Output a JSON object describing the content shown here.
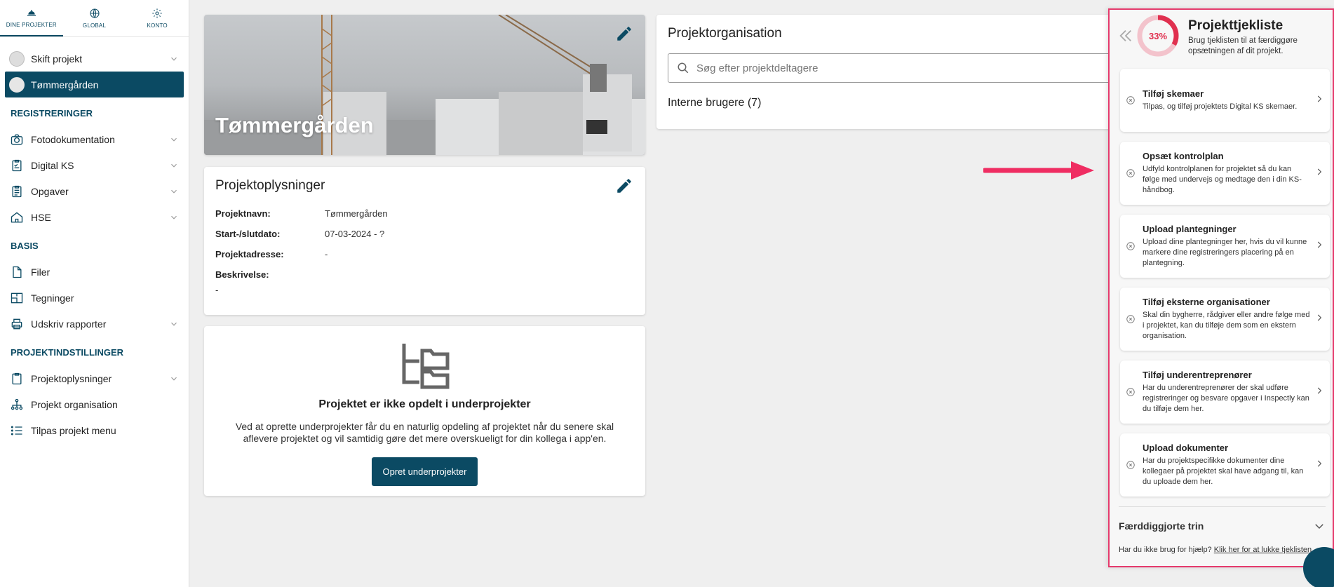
{
  "topnav": [
    {
      "label": "DINE PROJEKTER",
      "icon": "helmet-icon"
    },
    {
      "label": "GLOBAL",
      "icon": "globe-icon"
    },
    {
      "label": "KONTO",
      "icon": "gear-icon"
    }
  ],
  "sidebar": {
    "switch_project": "Skift projekt",
    "current_project": "Tømmergården",
    "sections": {
      "registreringer": "REGISTRERINGER",
      "basis": "BASIS",
      "projektindstillinger": "PROJEKTINDSTILLINGER"
    },
    "registreringer_items": [
      "Fotodokumentation",
      "Digital KS",
      "Opgaver",
      "HSE"
    ],
    "basis_items": [
      "Filer",
      "Tegninger",
      "Udskriv rapporter"
    ],
    "settings_items": [
      "Projektoplysninger",
      "Projekt organisation",
      "Tilpas projekt menu"
    ]
  },
  "hero": {
    "title": "Tømmergården"
  },
  "info": {
    "heading": "Projektoplysninger",
    "rows": [
      {
        "k": "Projektnavn:",
        "v": "Tømmergården"
      },
      {
        "k": "Start-/slutdato:",
        "v": "07-03-2024 - ?"
      },
      {
        "k": "Projektadresse:",
        "v": "-"
      },
      {
        "k": "Beskrivelse:",
        "v": "-"
      }
    ]
  },
  "subprojects": {
    "heading": "Projektet er ikke opdelt i underprojekter",
    "text": "Ved at oprette underprojekter får du en naturlig opdeling af projektet når du senere skal aflevere projektet og vil samtidig gøre det mere overskueligt for din kollega i app'en.",
    "button": "Opret underprojekter"
  },
  "org": {
    "heading": "Projektorganisation",
    "search_placeholder": "Søg efter projektdeltagere",
    "internal_users": "Interne brugere (7)"
  },
  "checklist": {
    "title": "Projekttjekliste",
    "progress_label": "33%",
    "progress": 0.33,
    "accent": "#e0304f",
    "subtitle": "Brug tjeklisten til at færdiggøre opsætningen af dit projekt.",
    "items": [
      {
        "title": "Tilføj skemaer",
        "desc": "Tilpas, og tilføj projektets Digital KS skemaer."
      },
      {
        "title": "Opsæt kontrolplan",
        "desc": "Udfyld kontrolplanen for projektet så du kan følge med undervejs og medtage den i din KS-håndbog."
      },
      {
        "title": "Upload plantegninger",
        "desc": "Upload dine plantegninger her, hvis du vil kunne markere dine registreringers placering på en plantegning."
      },
      {
        "title": "Tilføj eksterne organisationer",
        "desc": "Skal din bygherre, rådgiver eller andre følge med i projektet, kan du tilføje dem som en ekstern organisation."
      },
      {
        "title": "Tilføj underentreprenører",
        "desc": "Har du underentreprenører der skal udføre registreringer og besvare opgaver i Inspectly kan du tilføje dem her."
      },
      {
        "title": "Upload dokumenter",
        "desc": "Har du projektspecifikke dokumenter dine kollegaer på projektet skal have adgang til, kan du uploade dem her."
      }
    ],
    "completed": "Færddiggjorte trin",
    "footer_text": "Har du ikke brug for hjælp?",
    "footer_link": "Klik her for at lukke tjeklisten"
  }
}
